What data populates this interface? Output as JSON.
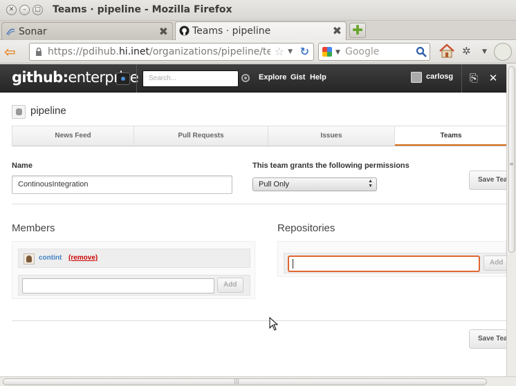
{
  "window": {
    "title": "Teams · pipeline - Mozilla Firefox"
  },
  "tabs": [
    {
      "label": "Sonar",
      "active": false
    },
    {
      "label": "Teams · pipeline",
      "active": true
    }
  ],
  "nav": {
    "url_prefix": "https://pdihub.",
    "url_domain": "hi.inet",
    "url_suffix": "/organizations/pipeline/te",
    "search_placeholder": "Google"
  },
  "header": {
    "logo_bold": "github:",
    "logo_rest": "enterprise",
    "search_placeholder": "Search...",
    "nav": [
      "Explore",
      "Gist",
      "Help"
    ],
    "username": "carlosg"
  },
  "page": {
    "org_name": "pipeline",
    "subnav": [
      {
        "label": "News Feed",
        "active": false
      },
      {
        "label": "Pull Requests",
        "active": false
      },
      {
        "label": "Issues",
        "active": false
      },
      {
        "label": "Teams",
        "active": true
      }
    ],
    "name_label": "Name",
    "name_value": "ContinousIntegration",
    "perm_label": "This team grants the following permissions",
    "perm_value": "Pull Only",
    "save_label": "Save Team",
    "members_title": "Members",
    "repos_title": "Repositories",
    "member": {
      "name": "contint",
      "remove": "(remove)"
    },
    "add_label": "Add"
  },
  "colors": {
    "accent_tab": "#d26911",
    "focus": "#e06630",
    "link": "#4183c4"
  }
}
